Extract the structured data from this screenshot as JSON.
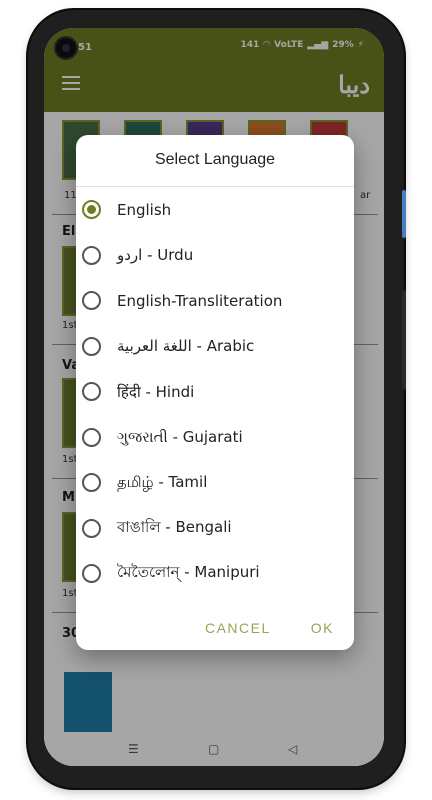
{
  "status_bar": {
    "time": "51",
    "speed": "141",
    "network": "VoLTE",
    "battery": "29%"
  },
  "app": {
    "logo_text": "دیبا"
  },
  "background": {
    "thumb_caption_left": "11",
    "thumb_caption_right": "ar",
    "heading_1": "El",
    "heading_2": "Va",
    "heading_3": "M",
    "heading_4": "30",
    "edition_1": "1st",
    "edition_2": "1st",
    "edition_3": "1st"
  },
  "dialog": {
    "title": "Select Language",
    "options": [
      {
        "label": "English",
        "selected": true
      },
      {
        "label": "اردو - Urdu",
        "selected": false
      },
      {
        "label": "English-Transliteration",
        "selected": false
      },
      {
        "label": "اللغة العربية - Arabic",
        "selected": false
      },
      {
        "label": "हिंदी - Hindi",
        "selected": false
      },
      {
        "label": "ગુજરાતી - Gujarati",
        "selected": false
      },
      {
        "label": "தமிழ் - Tamil",
        "selected": false
      },
      {
        "label": "বাঙালি - Bengali",
        "selected": false
      },
      {
        "label": "মৈতৈলোন্ - Manipuri",
        "selected": false
      }
    ],
    "cancel_label": "CANCEL",
    "ok_label": "OK"
  },
  "colors": {
    "accent": "#6f7d22",
    "action_text": "#9aa25a"
  }
}
